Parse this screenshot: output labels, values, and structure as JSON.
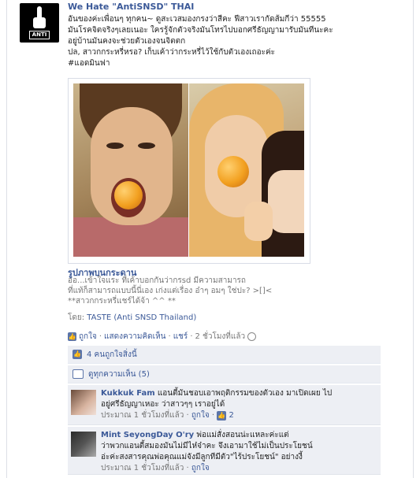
{
  "post": {
    "author": "We Hate \"AntiSNSD\" THAI",
    "avatar_text": "ANTI",
    "lines": [
      "อันของค่ะเพื่อนๆ ทุกคน~ ดูสะเวสมองกรงว่าสีคะ ฟีสาวเรากัดส้มกีว่า 55555",
      "มันโรคจิตจริงๆเลยเนอะ ใครรู้จักตัวจริงมันโทรไปบอกศรีธัญญามารับมันทีนะคะ",
      "อยู่บ้านมันคงจะช่วยตัวเองจนจิตตก",
      "ปล, สาวกกระหรี่หรอ? เก็บเค้าว่ากระหรี่ไว้ใช้กับตัวเองเถอะค่ะ",
      "#แอดมินฟา"
    ]
  },
  "album": {
    "title": "รูปภาพบนกระดาน",
    "lines": [
      "อ่อ...เข้าใจแระ ที่เค้าบอกกันว่ากรsd มีความสามารถ",
      "ที่แท้ก็สามารถแบบนี้นี่เอง เก่งแต่เรื่อง อ๋าๆ อมๆ ใช่ปะ? >[]<",
      "**สาวกกระหรี่แชร์ได้จ้า ^^ **"
    ],
    "by_label": "โดย: ",
    "by_name": "TASTE (Anti SNSD Thailand)"
  },
  "actions": {
    "like": "ถูกใจ",
    "comment": "แสดงความคิดเห็น",
    "share": "แชร์",
    "time": "2 ชั่วโมงที่แล้ว",
    "sep": " · "
  },
  "ufi": {
    "likes_text": "4 คนถูกใจสิ่งนี้",
    "view_all": "ดูทุกความเห็น (5)"
  },
  "comments": [
    {
      "name": "Kukkuk Fam",
      "text_lines": [
        "แอนตี้มันชอบเอาพฤติกรรมของตัวเอง มาเปิดเผย ไป",
        "อยู่ศรีธัญญาเหอะ ว่าสาวๆๆ เราอยู่ได้"
      ],
      "time": "ประมาณ 1 ชั่วโมงที่แล้ว",
      "like": "ถูกใจ",
      "likes": "2"
    },
    {
      "name": "Mint SeyongDay O'ry",
      "text_lines": [
        "พ่อแม่สั่งสอนน่ะแหละค่ะแต่",
        "ว่าพวกแอนตี้สมองมันไม่มีไห๋จ๋าคะ จึงเอามาใช้ไม่เป็นประโยชน์",
        "อ่ะค่ะสงสารคุณพ่อคุณแม่จังมีลูกทีมีตัว\"ไร้ประโยชน์\" อย่างงี้"
      ],
      "time": "ประมาณ 1 ชั่วโมงที่แล้ว",
      "like": "ถูกใจ"
    }
  ],
  "colors": {
    "link": "#3b5998",
    "ufi_bg": "#edeff4"
  },
  "icons": [
    "middle-finger-icon",
    "like-icon",
    "globe-icon",
    "thumbs-up-icon",
    "comment-icon"
  ]
}
